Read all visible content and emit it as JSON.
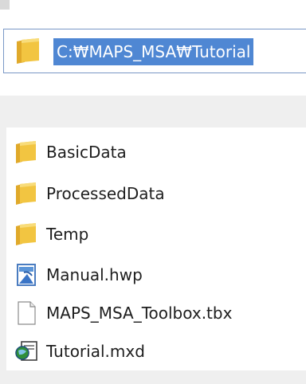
{
  "address_bar": {
    "path": "C:₩MAPS_MSA₩Tutorial",
    "icon": "folder-icon"
  },
  "files": [
    {
      "name": "BasicData",
      "icon": "folder-icon"
    },
    {
      "name": "ProcessedData",
      "icon": "folder-icon"
    },
    {
      "name": "Temp",
      "icon": "folder-icon"
    },
    {
      "name": "Manual.hwp",
      "icon": "hwp-document-icon"
    },
    {
      "name": "MAPS_MSA_Toolbox.tbx",
      "icon": "blank-file-icon"
    },
    {
      "name": "Tutorial.mxd",
      "icon": "arcmap-document-icon"
    }
  ],
  "colors": {
    "selection": "#4f87d3",
    "folder": "#f2c541",
    "address_border": "#7a98c6"
  }
}
